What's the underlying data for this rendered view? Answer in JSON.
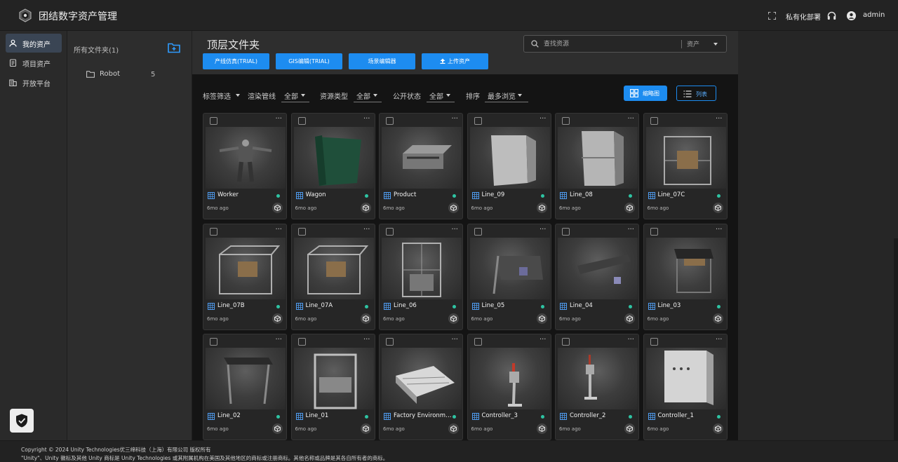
{
  "app": {
    "title": "团结数字资产管理",
    "deploy_label": "私有化部署",
    "user": "admin"
  },
  "nav": {
    "items": [
      {
        "label": "我的资产",
        "active": true
      },
      {
        "label": "项目资产",
        "active": false
      },
      {
        "label": "开放平台",
        "active": false
      }
    ]
  },
  "folders": {
    "title": "所有文件夹(1)",
    "items": [
      {
        "name": "Robot",
        "count": "5"
      }
    ]
  },
  "main": {
    "title": "顶层文件夹",
    "buttons": {
      "line_sim": "产线仿真(TRIAL)",
      "gis_edit": "GIS编辑(TRIAL)",
      "scene_edit": "场景编辑器",
      "upload": "上传资产"
    },
    "search": {
      "placeholder": "查找资源",
      "scope": "资产"
    },
    "filters": {
      "tag_filter": "标签筛选",
      "pipeline_label": "渲染管线",
      "pipeline_value": "全部",
      "type_label": "资源类型",
      "type_value": "全部",
      "visibility_label": "公开状态",
      "visibility_value": "全部",
      "sort_label": "排序",
      "sort_value": "最多浏览"
    },
    "view": {
      "grid": "缩略图",
      "list": "列表"
    }
  },
  "assets": [
    {
      "name": "Worker",
      "time": "6mo ago"
    },
    {
      "name": "Wagon",
      "time": "6mo ago"
    },
    {
      "name": "Product",
      "time": "6mo ago"
    },
    {
      "name": "Line_09",
      "time": "6mo ago"
    },
    {
      "name": "Line_08",
      "time": "6mo ago"
    },
    {
      "name": "Line_07C",
      "time": "6mo ago"
    },
    {
      "name": "Line_07B",
      "time": "6mo ago"
    },
    {
      "name": "Line_07A",
      "time": "6mo ago"
    },
    {
      "name": "Line_06",
      "time": "6mo ago"
    },
    {
      "name": "Line_05",
      "time": "6mo ago"
    },
    {
      "name": "Line_04",
      "time": "6mo ago"
    },
    {
      "name": "Line_03",
      "time": "6mo ago"
    },
    {
      "name": "Line_02",
      "time": "6mo ago"
    },
    {
      "name": "Line_01",
      "time": "6mo ago"
    },
    {
      "name": "Factory Environment",
      "time": "6mo ago"
    },
    {
      "name": "Controller_3",
      "time": "6mo ago"
    },
    {
      "name": "Controller_2",
      "time": "6mo ago"
    },
    {
      "name": "Controller_1",
      "time": "6mo ago"
    }
  ],
  "footer": {
    "copyright": "Copyright © 2024 Unity Technologies优三缔科技（上海）有限公司 版权所有",
    "trademark": "\"Unity\"、Unity 徽标及其他 Unity 商标是 Unity Technologies 或其附属机构在美国及其他地区的商标或注册商标。其他名称或品牌是其各自所有者的商标。"
  },
  "colors": {
    "accent": "#1d8cf0",
    "status_online": "#2ec4a3"
  }
}
